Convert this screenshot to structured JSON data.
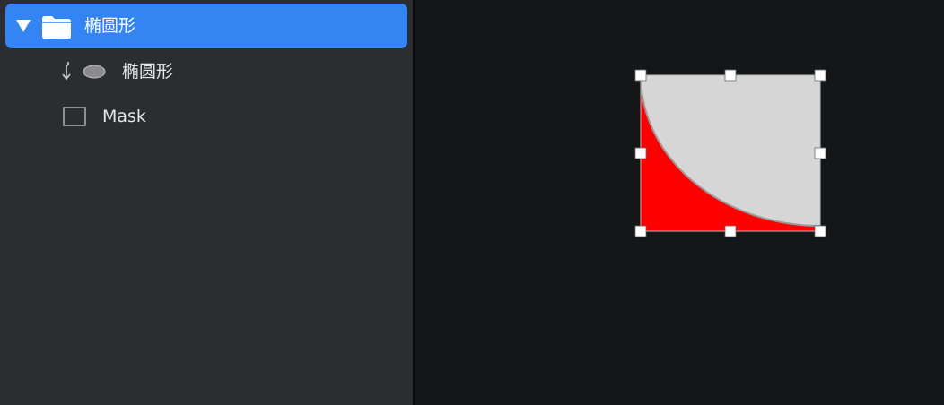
{
  "layers_panel": {
    "group": {
      "label": "椭圆形",
      "expanded": true,
      "selected": true,
      "icon": "folder-icon",
      "children": [
        {
          "label": "椭圆形",
          "icon": "ellipse-icon",
          "masked": true
        },
        {
          "label": "Mask",
          "icon": "rectangle-icon"
        }
      ]
    }
  },
  "colors": {
    "selection": "#3584f3",
    "sidebar": "#2c2d30",
    "canvas": "#151618",
    "mask_fill": "#ff0000",
    "ellipse_fill": "#d6d6d6"
  }
}
